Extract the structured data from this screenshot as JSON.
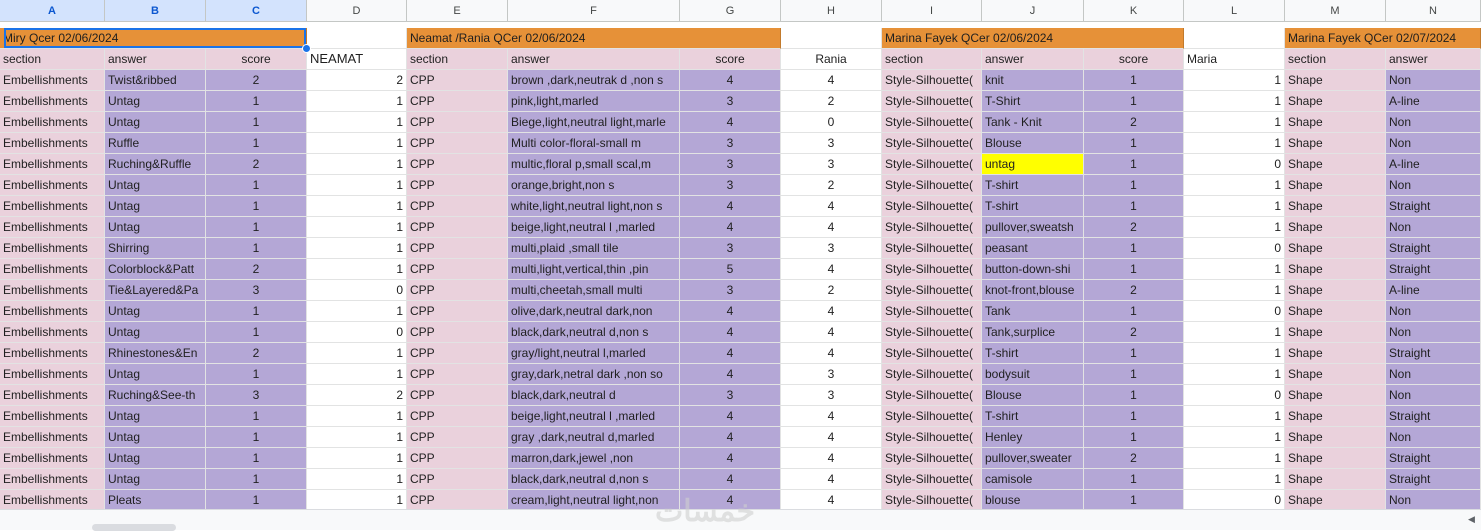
{
  "colors": {
    "orange": "#e69138",
    "pink": "#ead1dc",
    "purple": "#b4a7d6",
    "white": "#ffffff",
    "yellow": "#ffff00",
    "headerbg": "#f8f9fa",
    "selected_header": "#d3e3fd"
  },
  "columns": [
    "A",
    "B",
    "C",
    "D",
    "E",
    "F",
    "G",
    "H",
    "I",
    "J",
    "K",
    "L",
    "M",
    "N"
  ],
  "selected_columns": [
    "A",
    "B",
    "C"
  ],
  "sheet": {
    "title_row": [
      {
        "col": "A",
        "text": "Miry Qcer 02/06/2024"
      },
      {
        "col": "E",
        "text": "Neamat /Rania QCer 02/06/2024"
      },
      {
        "col": "I",
        "text": "Marina Fayek QCer 02/06/2024"
      },
      {
        "col": "M",
        "text": "Marina Fayek QCer 02/07/2024"
      }
    ],
    "header_row": [
      "section",
      "answer",
      "score",
      "NEAMAT",
      "section",
      "answer",
      "score",
      "Rania",
      "section",
      "answer",
      "score",
      "Maria",
      "section",
      "answer"
    ],
    "rows": [
      [
        "Embellishments",
        "Twist&ribbed",
        "2",
        "2",
        "CPP",
        "brown ,dark,neutrak d ,non s",
        "4",
        "4",
        "Style-Silhouette(",
        "knit",
        "1",
        "1",
        "Shape",
        "Non"
      ],
      [
        "Embellishments",
        "Untag",
        "1",
        "1",
        "CPP",
        "pink,light,marled",
        "3",
        "2",
        "Style-Silhouette(",
        "T-Shirt",
        "1",
        "1",
        "Shape",
        "A-line"
      ],
      [
        "Embellishments",
        "Untag",
        "1",
        "1",
        "CPP",
        "Biege,light,neutral light,marle",
        "4",
        "0",
        "Style-Silhouette(",
        "Tank - Knit",
        "2",
        "1",
        "Shape",
        "Non"
      ],
      [
        "Embellishments",
        "Ruffle",
        "1",
        "1",
        "CPP",
        "Multi color-floral-small m",
        "3",
        "3",
        "Style-Silhouette(",
        "Blouse",
        "1",
        "1",
        "Shape",
        "Non"
      ],
      [
        "Embellishments",
        "Ruching&Ruffle",
        "2",
        "1",
        "CPP",
        "multic,floral p,small scal,m",
        "3",
        "3",
        "Style-Silhouette(",
        "untag",
        "1",
        "0",
        "Shape",
        "A-line"
      ],
      [
        "Embellishments",
        "Untag",
        "1",
        "1",
        "CPP",
        "orange,bright,non s",
        "3",
        "2",
        "Style-Silhouette(",
        "T-shirt",
        "1",
        "1",
        "Shape",
        "Non"
      ],
      [
        "Embellishments",
        "Untag",
        "1",
        "1",
        "CPP",
        "white,light,neutral light,non s",
        "4",
        "4",
        "Style-Silhouette(",
        "T-shirt",
        "1",
        "1",
        "Shape",
        "Straight"
      ],
      [
        "Embellishments",
        "Untag",
        "1",
        "1",
        "CPP",
        "beige,light,neutral l ,marled",
        "4",
        "4",
        "Style-Silhouette(",
        "pullover,sweatsh",
        "2",
        "1",
        "Shape",
        "Non"
      ],
      [
        "Embellishments",
        "Shirring",
        "1",
        "1",
        "CPP",
        "multi,plaid ,small tile",
        "3",
        "3",
        "Style-Silhouette(",
        "peasant",
        "1",
        "0",
        "Shape",
        "Straight"
      ],
      [
        "Embellishments",
        "Colorblock&Patt",
        "2",
        "1",
        "CPP",
        "multi,light,vertical,thin ,pin",
        "5",
        "4",
        "Style-Silhouette(",
        "button-down-shi",
        "1",
        "1",
        "Shape",
        "Straight"
      ],
      [
        "Embellishments",
        "Tie&Layered&Pa",
        "3",
        "0",
        "CPP",
        "multi,cheetah,small multi",
        "3",
        "2",
        "Style-Silhouette(",
        "knot-front,blouse",
        "2",
        "1",
        "Shape",
        "A-line"
      ],
      [
        "Embellishments",
        "Untag",
        "1",
        "1",
        "CPP",
        "olive,dark,neutral dark,non",
        "4",
        "4",
        "Style-Silhouette(",
        "Tank",
        "1",
        "0",
        "Shape",
        "Non"
      ],
      [
        "Embellishments",
        "Untag",
        "1",
        "0",
        "CPP",
        "black,dark,neutral d,non s",
        "4",
        "4",
        "Style-Silhouette(",
        "Tank,surplice",
        "2",
        "1",
        "Shape",
        "Non"
      ],
      [
        "Embellishments",
        "Rhinestones&En",
        "2",
        "1",
        "CPP",
        "gray/light,neutral l,marled",
        "4",
        "4",
        "Style-Silhouette(",
        "T-shirt",
        "1",
        "1",
        "Shape",
        "Straight"
      ],
      [
        "Embellishments",
        "Untag",
        "1",
        "1",
        "CPP",
        "gray,dark,netral dark ,non so",
        "4",
        "3",
        "Style-Silhouette(",
        "bodysuit",
        "1",
        "1",
        "Shape",
        "Non"
      ],
      [
        "Embellishments",
        "Ruching&See-th",
        "3",
        "2",
        "CPP",
        "black,dark,neutral d",
        "3",
        "3",
        "Style-Silhouette(",
        "Blouse",
        "1",
        "0",
        "Shape",
        "Non"
      ],
      [
        "Embellishments",
        "Untag",
        "1",
        "1",
        "CPP",
        "beige,light,neutral l ,marled",
        "4",
        "4",
        "Style-Silhouette(",
        "T-shirt",
        "1",
        "1",
        "Shape",
        "Straight"
      ],
      [
        "Embellishments",
        "Untag",
        "1",
        "1",
        "CPP",
        "gray ,dark,neutral d,marled",
        "4",
        "4",
        "Style-Silhouette(",
        "Henley",
        "1",
        "1",
        "Shape",
        "Non"
      ],
      [
        "Embellishments",
        "Untag",
        "1",
        "1",
        "CPP",
        "marron,dark,jewel ,non",
        "4",
        "4",
        "Style-Silhouette(",
        "pullover,sweater",
        "2",
        "1",
        "Shape",
        "Straight"
      ],
      [
        "Embellishments",
        "Untag",
        "1",
        "1",
        "CPP",
        "black,dark,neutral d,non s",
        "4",
        "4",
        "Style-Silhouette(",
        "camisole",
        "1",
        "1",
        "Shape",
        "Straight"
      ],
      [
        "Embellishments",
        "Pleats",
        "1",
        "1",
        "CPP",
        "cream,light,neutral light,non",
        "4",
        "4",
        "Style-Silhouette(",
        "blouse",
        "1",
        "0",
        "Shape",
        "Non"
      ]
    ],
    "highlighted_cell": {
      "row": 4,
      "col": 9,
      "color": "#ffff00"
    }
  }
}
